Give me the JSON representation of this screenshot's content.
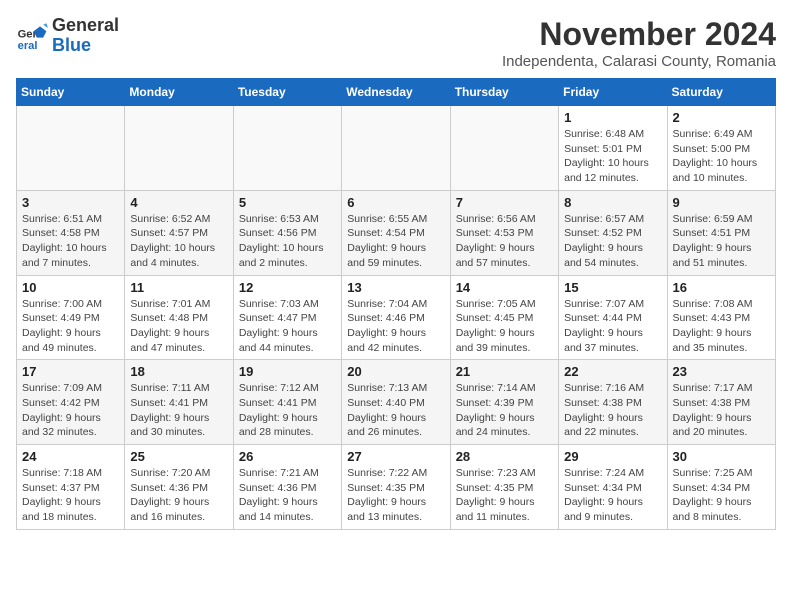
{
  "header": {
    "logo_general": "General",
    "logo_blue": "Blue",
    "month_year": "November 2024",
    "location": "Independenta, Calarasi County, Romania"
  },
  "weekdays": [
    "Sunday",
    "Monday",
    "Tuesday",
    "Wednesday",
    "Thursday",
    "Friday",
    "Saturday"
  ],
  "weeks": [
    [
      {
        "day": "",
        "info": ""
      },
      {
        "day": "",
        "info": ""
      },
      {
        "day": "",
        "info": ""
      },
      {
        "day": "",
        "info": ""
      },
      {
        "day": "",
        "info": ""
      },
      {
        "day": "1",
        "info": "Sunrise: 6:48 AM\nSunset: 5:01 PM\nDaylight: 10 hours and 12 minutes."
      },
      {
        "day": "2",
        "info": "Sunrise: 6:49 AM\nSunset: 5:00 PM\nDaylight: 10 hours and 10 minutes."
      }
    ],
    [
      {
        "day": "3",
        "info": "Sunrise: 6:51 AM\nSunset: 4:58 PM\nDaylight: 10 hours and 7 minutes."
      },
      {
        "day": "4",
        "info": "Sunrise: 6:52 AM\nSunset: 4:57 PM\nDaylight: 10 hours and 4 minutes."
      },
      {
        "day": "5",
        "info": "Sunrise: 6:53 AM\nSunset: 4:56 PM\nDaylight: 10 hours and 2 minutes."
      },
      {
        "day": "6",
        "info": "Sunrise: 6:55 AM\nSunset: 4:54 PM\nDaylight: 9 hours and 59 minutes."
      },
      {
        "day": "7",
        "info": "Sunrise: 6:56 AM\nSunset: 4:53 PM\nDaylight: 9 hours and 57 minutes."
      },
      {
        "day": "8",
        "info": "Sunrise: 6:57 AM\nSunset: 4:52 PM\nDaylight: 9 hours and 54 minutes."
      },
      {
        "day": "9",
        "info": "Sunrise: 6:59 AM\nSunset: 4:51 PM\nDaylight: 9 hours and 51 minutes."
      }
    ],
    [
      {
        "day": "10",
        "info": "Sunrise: 7:00 AM\nSunset: 4:49 PM\nDaylight: 9 hours and 49 minutes."
      },
      {
        "day": "11",
        "info": "Sunrise: 7:01 AM\nSunset: 4:48 PM\nDaylight: 9 hours and 47 minutes."
      },
      {
        "day": "12",
        "info": "Sunrise: 7:03 AM\nSunset: 4:47 PM\nDaylight: 9 hours and 44 minutes."
      },
      {
        "day": "13",
        "info": "Sunrise: 7:04 AM\nSunset: 4:46 PM\nDaylight: 9 hours and 42 minutes."
      },
      {
        "day": "14",
        "info": "Sunrise: 7:05 AM\nSunset: 4:45 PM\nDaylight: 9 hours and 39 minutes."
      },
      {
        "day": "15",
        "info": "Sunrise: 7:07 AM\nSunset: 4:44 PM\nDaylight: 9 hours and 37 minutes."
      },
      {
        "day": "16",
        "info": "Sunrise: 7:08 AM\nSunset: 4:43 PM\nDaylight: 9 hours and 35 minutes."
      }
    ],
    [
      {
        "day": "17",
        "info": "Sunrise: 7:09 AM\nSunset: 4:42 PM\nDaylight: 9 hours and 32 minutes."
      },
      {
        "day": "18",
        "info": "Sunrise: 7:11 AM\nSunset: 4:41 PM\nDaylight: 9 hours and 30 minutes."
      },
      {
        "day": "19",
        "info": "Sunrise: 7:12 AM\nSunset: 4:41 PM\nDaylight: 9 hours and 28 minutes."
      },
      {
        "day": "20",
        "info": "Sunrise: 7:13 AM\nSunset: 4:40 PM\nDaylight: 9 hours and 26 minutes."
      },
      {
        "day": "21",
        "info": "Sunrise: 7:14 AM\nSunset: 4:39 PM\nDaylight: 9 hours and 24 minutes."
      },
      {
        "day": "22",
        "info": "Sunrise: 7:16 AM\nSunset: 4:38 PM\nDaylight: 9 hours and 22 minutes."
      },
      {
        "day": "23",
        "info": "Sunrise: 7:17 AM\nSunset: 4:38 PM\nDaylight: 9 hours and 20 minutes."
      }
    ],
    [
      {
        "day": "24",
        "info": "Sunrise: 7:18 AM\nSunset: 4:37 PM\nDaylight: 9 hours and 18 minutes."
      },
      {
        "day": "25",
        "info": "Sunrise: 7:20 AM\nSunset: 4:36 PM\nDaylight: 9 hours and 16 minutes."
      },
      {
        "day": "26",
        "info": "Sunrise: 7:21 AM\nSunset: 4:36 PM\nDaylight: 9 hours and 14 minutes."
      },
      {
        "day": "27",
        "info": "Sunrise: 7:22 AM\nSunset: 4:35 PM\nDaylight: 9 hours and 13 minutes."
      },
      {
        "day": "28",
        "info": "Sunrise: 7:23 AM\nSunset: 4:35 PM\nDaylight: 9 hours and 11 minutes."
      },
      {
        "day": "29",
        "info": "Sunrise: 7:24 AM\nSunset: 4:34 PM\nDaylight: 9 hours and 9 minutes."
      },
      {
        "day": "30",
        "info": "Sunrise: 7:25 AM\nSunset: 4:34 PM\nDaylight: 9 hours and 8 minutes."
      }
    ]
  ]
}
